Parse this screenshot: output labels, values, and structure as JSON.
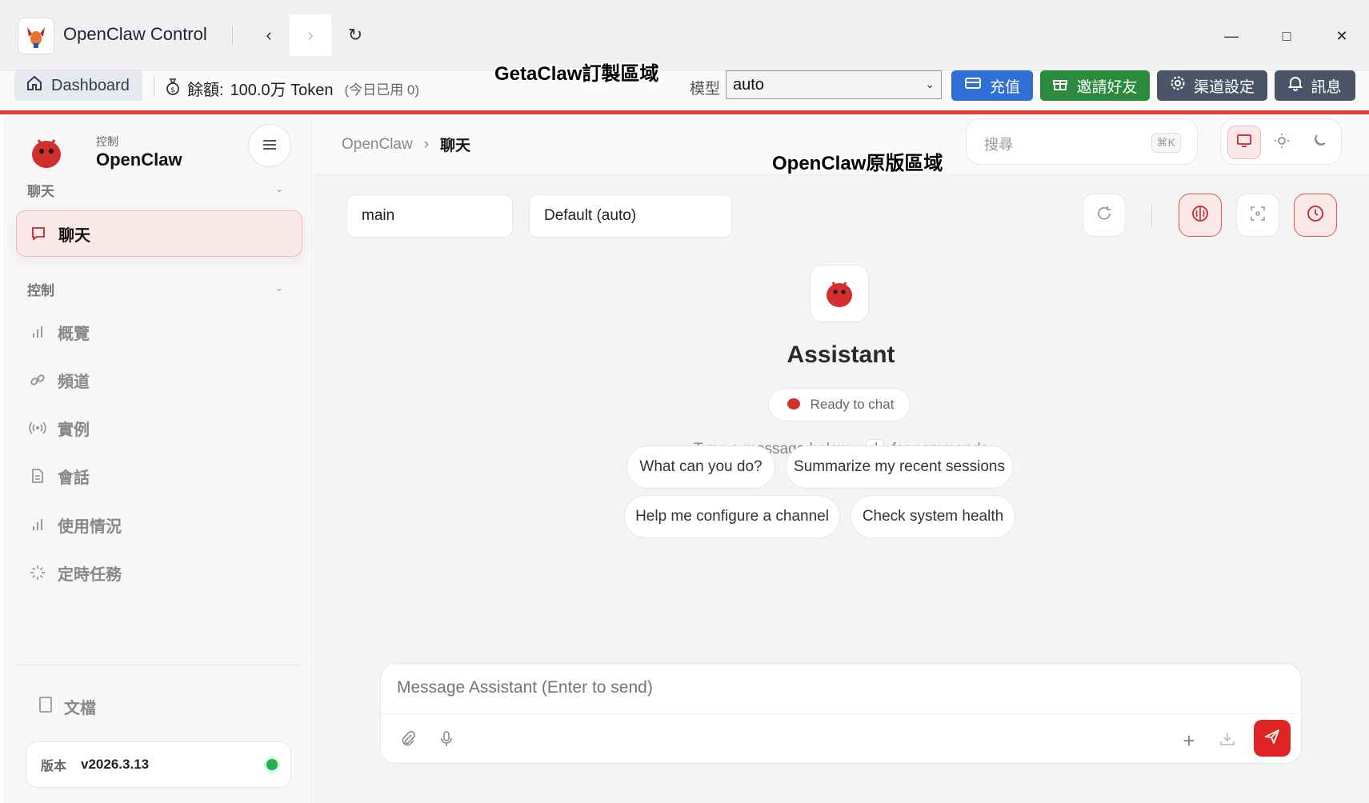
{
  "titlebar": {
    "app_title": "OpenClaw Control",
    "back_glyph": "‹",
    "forward_glyph": "›",
    "reload_glyph": "↻",
    "minimize_glyph": "—",
    "maximize_glyph": "□",
    "close_glyph": "✕"
  },
  "overlays": {
    "custom_area": "GetaClaw訂製區域",
    "original_area": "OpenClaw原版區域"
  },
  "custom_bar": {
    "dashboard_label": "Dashboard",
    "balance_label": "餘額:",
    "balance_value": "100.0万 Token",
    "today_used": "(今日已用 0)",
    "model_label": "模型",
    "model_value": "auto",
    "recharge_label": "充值",
    "invite_label": "邀請好友",
    "channel_settings_label": "渠道設定",
    "messages_label": "訊息",
    "colors": {
      "recharge": "#2f6fd6",
      "invite": "#2b8a3e",
      "settings": "#4a5568",
      "accent_line": "#e53935"
    }
  },
  "sidebar": {
    "brand_sub": "控制",
    "brand_name": "OpenClaw",
    "sections": [
      {
        "label": "聊天"
      },
      {
        "label": "控制"
      }
    ],
    "chat_item": {
      "label": "聊天",
      "icon": "chat-bubble-icon"
    },
    "items": [
      {
        "label": "概覽",
        "icon": "bar-chart-icon"
      },
      {
        "label": "頻道",
        "icon": "link-icon"
      },
      {
        "label": "實例",
        "icon": "broadcast-icon"
      },
      {
        "label": "會話",
        "icon": "document-icon"
      },
      {
        "label": "使用情況",
        "icon": "bar-chart-icon"
      },
      {
        "label": "定時任務",
        "icon": "loader-icon"
      }
    ],
    "docs_label": "文檔",
    "version_label": "版本",
    "version_value": "v2026.3.13"
  },
  "main": {
    "breadcrumb_root": "OpenClaw",
    "breadcrumb_sep": "›",
    "breadcrumb_current": "聊天",
    "search_placeholder": "搜尋",
    "search_shortcut": "⌘K",
    "session_value": "main",
    "model_value": "Default (auto)",
    "assistant_name": "Assistant",
    "ready_label": "Ready to chat",
    "hint_before": "Type a message below ·",
    "hint_key": "/",
    "hint_after": "for commands",
    "suggestions": [
      "What can you do?",
      "Summarize my recent sessions",
      "Help me configure a channel",
      "Check system health"
    ],
    "composer_placeholder": "Message Assistant (Enter to send)",
    "plus_glyph": "+"
  }
}
